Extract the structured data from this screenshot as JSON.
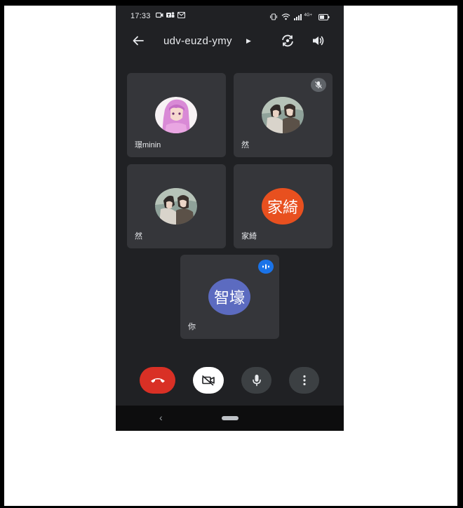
{
  "status_bar": {
    "time": "17:33",
    "notification_icons": [
      "video-icon",
      "teams-icon",
      "gmail-icon"
    ],
    "system_icons": [
      "vibrate-icon",
      "wifi-icon",
      "signal-icon",
      "battery-icon"
    ],
    "network_label": "4G+"
  },
  "top_bar": {
    "meeting_code": "udv-euzd-ymy",
    "icons": [
      "back-arrow-icon",
      "switch-camera-icon",
      "speaker-icon"
    ]
  },
  "participants": [
    {
      "name": "璟minin",
      "avatar": "anime-girl-photo",
      "muted": false
    },
    {
      "name": "然",
      "avatar": "anime-pair-photo",
      "muted": true
    },
    {
      "name": "然",
      "avatar": "anime-pair-photo",
      "muted": false
    },
    {
      "name": "家綺",
      "avatar_text": "家綺",
      "avatar_color": "#e8501f",
      "muted": false
    },
    {
      "name": "你",
      "avatar_text": "智壕",
      "avatar_color": "#5c6bc0",
      "speaking": true
    }
  ],
  "controls": {
    "end_call_color": "#d93025",
    "buttons": [
      "end-call-icon",
      "camera-off-icon",
      "microphone-icon",
      "more-options-icon"
    ]
  },
  "colors": {
    "background": "#202124",
    "tile": "#35363a",
    "accent_blue": "#1a73e8"
  },
  "nav": {
    "back_glyph": "‹"
  }
}
